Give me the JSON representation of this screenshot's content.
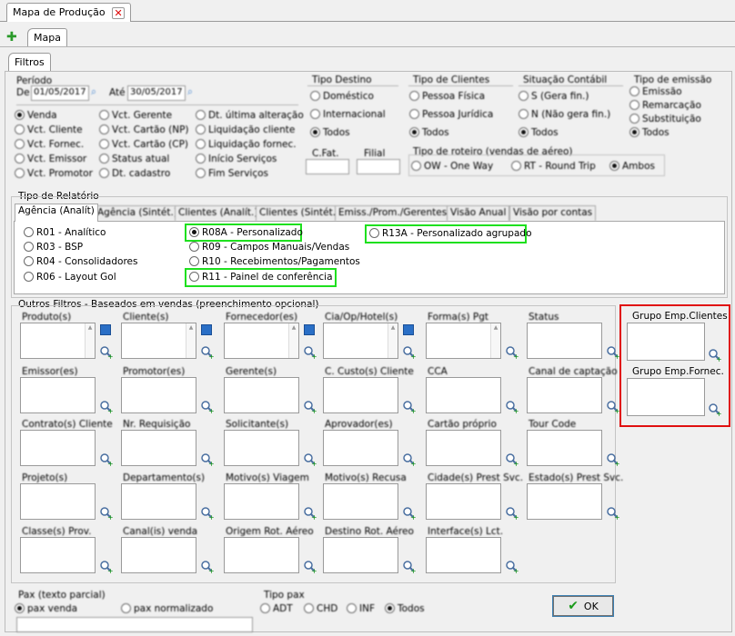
{
  "window_tab": {
    "title": "Mapa de Produção"
  },
  "subtab": {
    "label": "Mapa"
  },
  "filtros_tab": {
    "label": "Filtros"
  },
  "periodo": {
    "label": "Período",
    "de": "De",
    "de_val": "01/05/2017",
    "ate": "Até",
    "ate_val": "30/05/2017"
  },
  "data_radios": [
    "Venda",
    "Vct. Cliente",
    "Vct. Fornec.",
    "Vct. Emissor",
    "Vct. Promotor"
  ],
  "data_radios2": [
    "Vct. Gerente",
    "Vct. Cartão (NP)",
    "Vct. Cartão (CP)",
    "Status atual",
    "Dt. cadastro"
  ],
  "data_radios3": [
    "Dt. última alteração",
    "Liquidação cliente",
    "Liquidação fornec.",
    "Início Serviços",
    "Fim Serviços"
  ],
  "tipo_destino": {
    "label": "Tipo Destino",
    "options": [
      "Doméstico",
      "Internacional",
      "Todos"
    ]
  },
  "tipo_clientes": {
    "label": "Tipo de Clientes",
    "options": [
      "Pessoa Física",
      "Pessoa Jurídica",
      "Todos"
    ]
  },
  "situacao_contabil": {
    "label": "Situação Contábil",
    "options": [
      "S (Gera fin.)",
      "N (Não gera fin.)",
      "Todos"
    ]
  },
  "tipo_emissao": {
    "label": "Tipo de emissão",
    "options": [
      "Emissão",
      "Remarcação",
      "Substituição",
      "Todos"
    ]
  },
  "cfat": {
    "label": "C.Fat."
  },
  "filial": {
    "label": "Filial"
  },
  "tipo_roteiro": {
    "label": "Tipo de roteiro (vendas de aéreo)",
    "options": [
      "OW - One Way",
      "RT - Round Trip",
      "Ambos"
    ]
  },
  "tipo_relatorio": {
    "label": "Tipo de Relatório",
    "tabs": [
      "Agência (Analít)",
      "Agência (Sintét.)",
      "Clientes (Analít.)",
      "Clientes (Sintét.)",
      "Emiss./Prom./Gerentes",
      "Visão Anual",
      "Visão por contas"
    ]
  },
  "rel_col1": [
    "R01 - Analítico",
    "R03 - BSP",
    "R04 - Consolidadores",
    "R06 - Layout Gol"
  ],
  "rel_col2": [
    "R08A - Personalizado",
    "R09 - Campos Manuais/Vendas",
    "R10 - Recebimentos/Pagamentos",
    "R11 - Painel de conferência"
  ],
  "rel_col3": [
    "R13A - Personalizado agrupado"
  ],
  "outros": {
    "label": "Outros Filtros - Baseados em vendas (preenchimento opcional)"
  },
  "filter_rows": [
    [
      "Produto(s)",
      "Cliente(s)",
      "Fornecedor(es)",
      "Cia/Op/Hotel(s)",
      "Forma(s) Pgt",
      "Status"
    ],
    [
      "Emissor(es)",
      "Promotor(es)",
      "Gerente(s)",
      "C. Custo(s) Cliente",
      "CCA",
      "Canal de captação"
    ],
    [
      "Contrato(s) Cliente",
      "Nr. Requisição",
      "Solicitante(s)",
      "Aprovador(es)",
      "Cartão próprio",
      "Tour Code"
    ],
    [
      "Projeto(s)",
      "Departamento(s)",
      "Motivo(s) Viagem",
      "Motivo(s) Recusa",
      "Cidade(s) Prest Svc.",
      "Estado(s) Prest Svc."
    ],
    [
      "Classe(s) Prov.",
      "Canal(is) venda",
      "Origem Rot. Aéreo",
      "Destino Rot. Aéreo",
      "Interface(s) Lct."
    ]
  ],
  "grupo_clientes": {
    "label": "Grupo Emp.Clientes"
  },
  "grupo_fornec": {
    "label": "Grupo Emp.Fornec."
  },
  "pax": {
    "label": "Pax (texto parcial)",
    "options": [
      "pax venda",
      "pax normalizado"
    ]
  },
  "tipo_pax": {
    "label": "Tipo pax",
    "options": [
      "ADT",
      "CHD",
      "INF",
      "Todos"
    ]
  },
  "ok": {
    "label": "OK"
  },
  "colors": {
    "highlight_green": "#1ee01e",
    "highlight_red": "#e01010"
  }
}
